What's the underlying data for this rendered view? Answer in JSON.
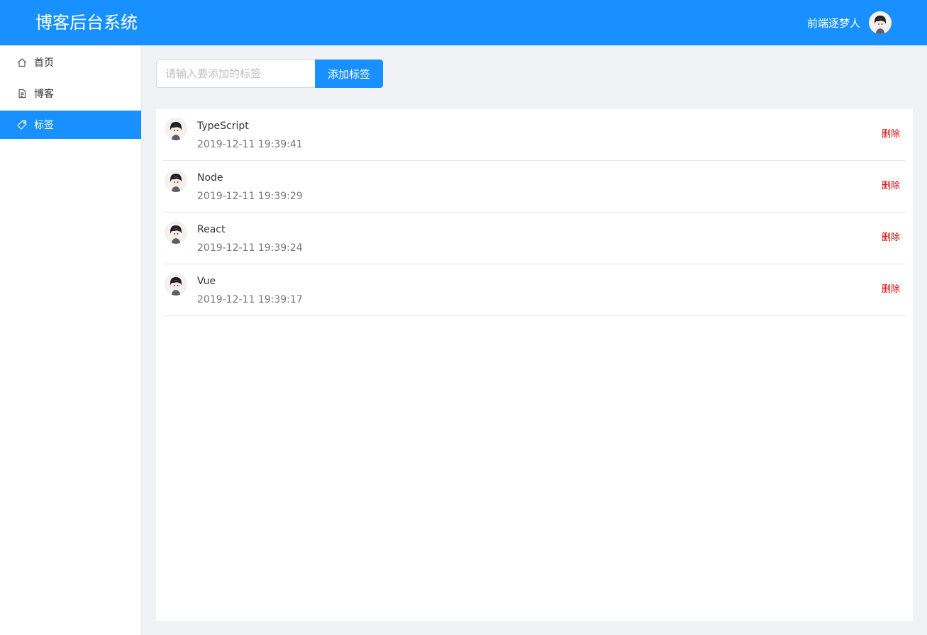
{
  "header": {
    "title": "博客后台系统",
    "username": "前端逐梦人"
  },
  "sidebar": {
    "items": [
      {
        "label": "首页",
        "icon": "home-icon",
        "active": false
      },
      {
        "label": "博客",
        "icon": "file-icon",
        "active": false
      },
      {
        "label": "标签",
        "icon": "tag-icon",
        "active": true
      }
    ]
  },
  "toolbar": {
    "input_placeholder": "请输入要添加的标签",
    "input_value": "",
    "add_label": "添加标签"
  },
  "tags": [
    {
      "name": "TypeScript",
      "time": "2019-12-11 19:39:41",
      "delete_label": "删除"
    },
    {
      "name": "Node",
      "time": "2019-12-11 19:39:29",
      "delete_label": "删除"
    },
    {
      "name": "React",
      "time": "2019-12-11 19:39:24",
      "delete_label": "删除"
    },
    {
      "name": "Vue",
      "time": "2019-12-11 19:39:17",
      "delete_label": "删除"
    }
  ],
  "colors": {
    "primary": "#1890ff",
    "danger": "#d40000",
    "background": "#f0f2f5"
  }
}
